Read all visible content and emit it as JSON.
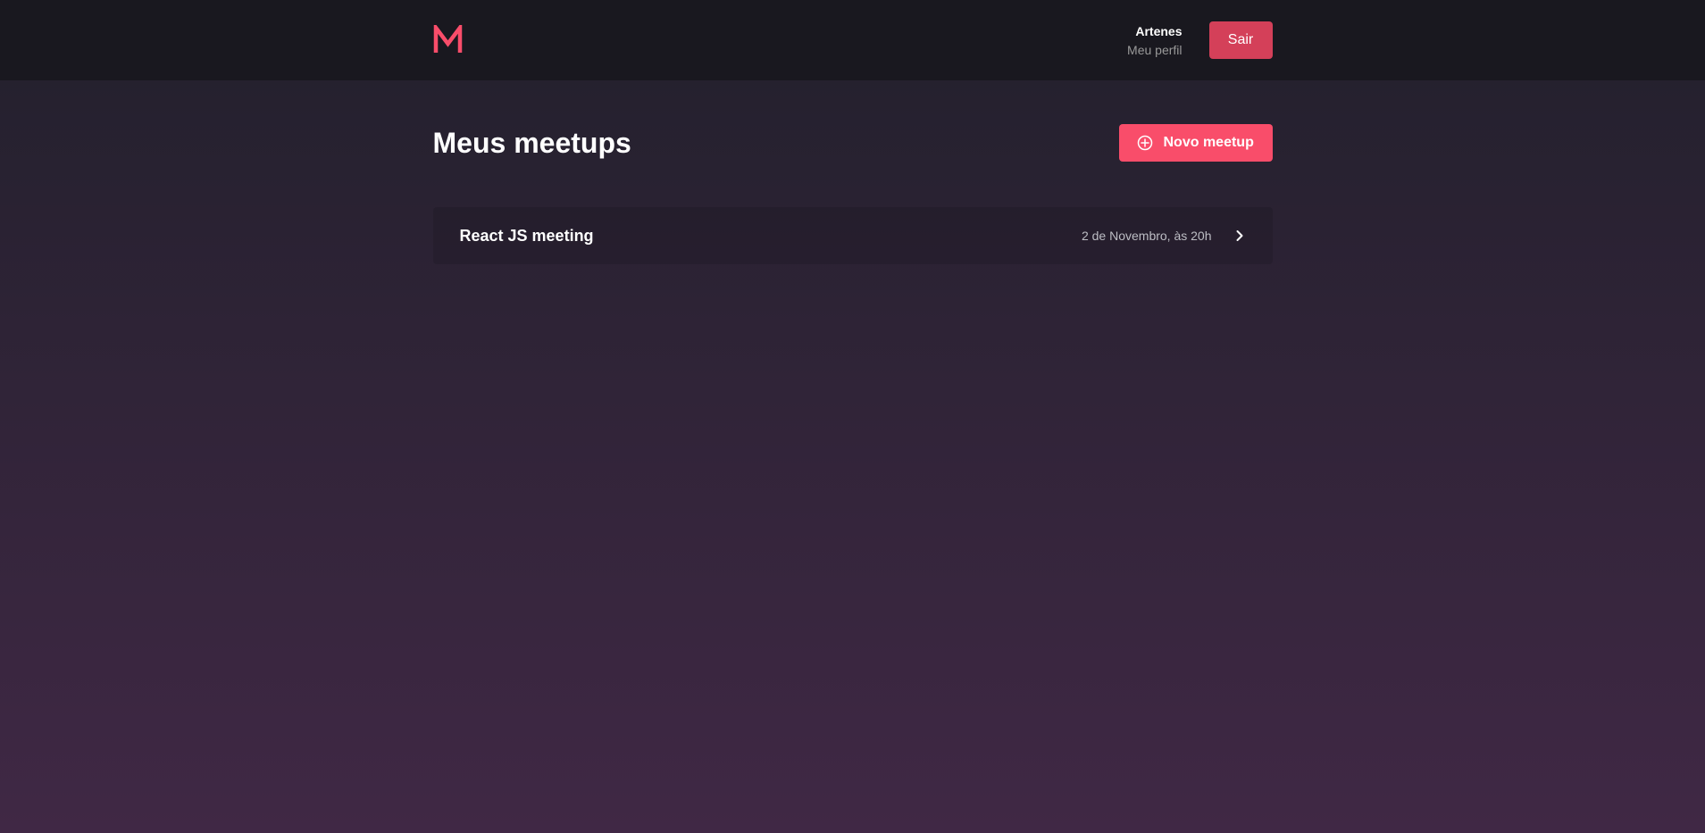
{
  "header": {
    "logo_letter": "M",
    "user_name": "Artenes",
    "profile_link_label": "Meu perfil",
    "logout_label": "Sair"
  },
  "main": {
    "title": "Meus meetups",
    "new_meetup_label": "Novo meetup",
    "meetups": [
      {
        "title": "React JS meeting",
        "date": "2 de Novembro, às 20h"
      }
    ]
  },
  "colors": {
    "accent": "#f94d6a",
    "logout_button": "#d44059",
    "header_bg": "#19181f",
    "bg_gradient_top": "#22202c",
    "bg_gradient_bottom": "#402845"
  },
  "icons": {
    "logo": "meetapp-logo-icon",
    "new_meetup": "plus-circle-icon",
    "meetup_open": "chevron-right-icon"
  }
}
